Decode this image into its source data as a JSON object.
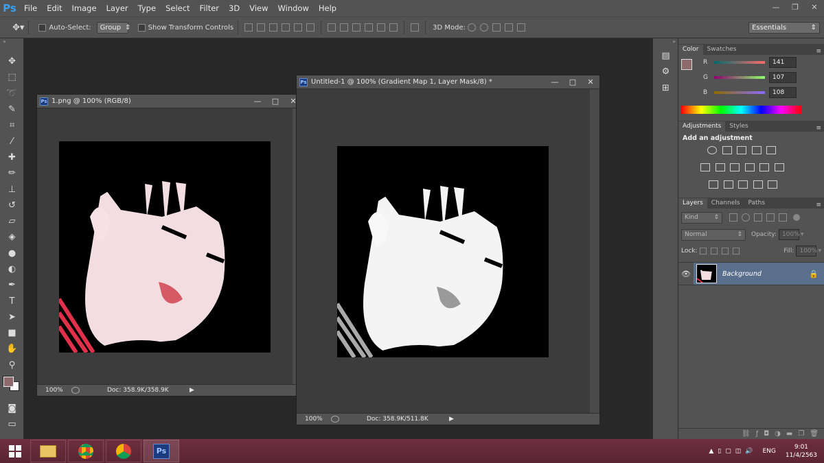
{
  "app": {
    "logo": "Ps"
  },
  "menu": [
    "File",
    "Edit",
    "Image",
    "Layer",
    "Type",
    "Select",
    "Filter",
    "3D",
    "View",
    "Window",
    "Help"
  ],
  "window_controls": {
    "minimize": "—",
    "restore": "❐",
    "close": "✕"
  },
  "options_bar": {
    "auto_select_label": "Auto-Select:",
    "auto_select_value": "Group",
    "transform_label": "Show Transform Controls",
    "mode_label": "3D Mode:",
    "workspace": "Essentials"
  },
  "doc1": {
    "title": "1.png @ 100% (RGB/8)",
    "zoom": "100%",
    "doc_size": "Doc: 358.9K/358.9K"
  },
  "doc2": {
    "title": "Untitled-1 @ 100% (Gradient Map 1, Layer Mask/8) *",
    "zoom": "100%",
    "doc_size": "Doc: 358.9K/511.8K"
  },
  "color_panel": {
    "tabs": [
      "Color",
      "Swatches"
    ],
    "r": {
      "label": "R",
      "value": "141"
    },
    "g": {
      "label": "G",
      "value": "107"
    },
    "b": {
      "label": "B",
      "value": "108"
    },
    "foreground": "#8d6b6c"
  },
  "adjustments_panel": {
    "tabs": [
      "Adjustments",
      "Styles"
    ],
    "heading": "Add an adjustment"
  },
  "layers_panel": {
    "tabs": [
      "Layers",
      "Channels",
      "Paths"
    ],
    "kind": "Kind",
    "blend": "Normal",
    "opacity_label": "Opacity:",
    "opacity_value": "100%",
    "lock_label": "Lock:",
    "fill_label": "Fill:",
    "fill_value": "100%",
    "layer_name": "Background"
  },
  "taskbar": {
    "lang": "ENG",
    "time": "9:01",
    "date": "11/4/2563",
    "ps_label": "Ps"
  }
}
